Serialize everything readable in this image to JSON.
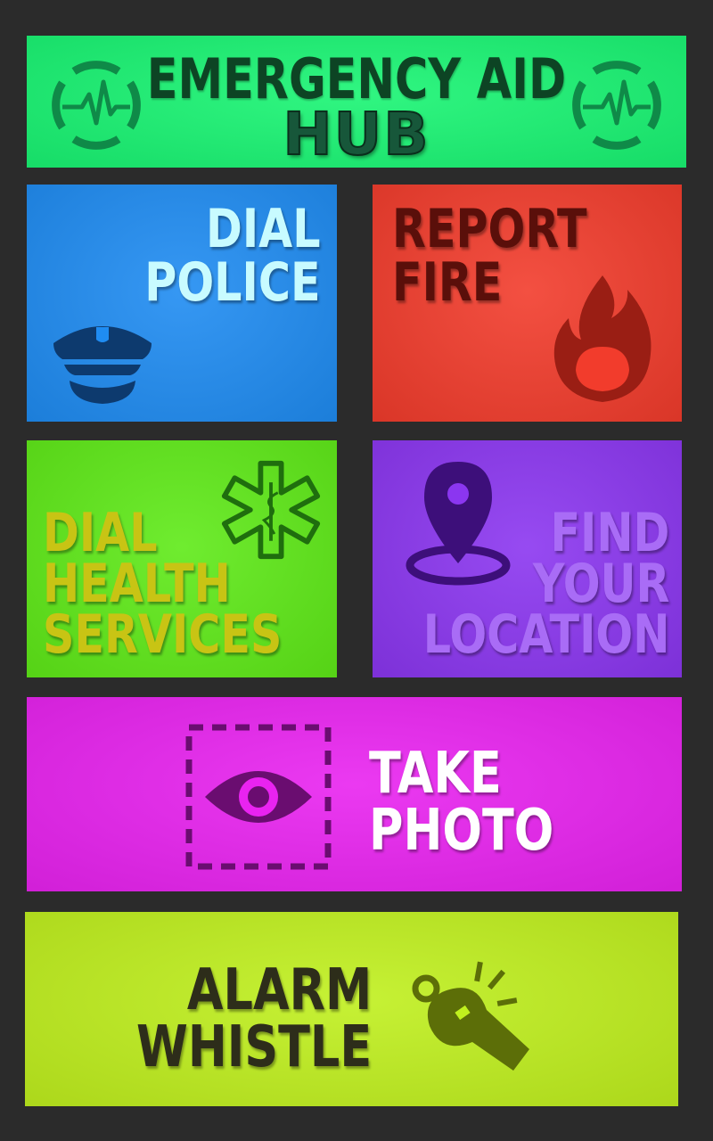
{
  "app": {
    "title_line1": "EMERGENCY AID",
    "title_line2": "HUB",
    "left_icon": "heartbeat-icon",
    "right_icon": "heartbeat-icon",
    "color": "#19f573"
  },
  "tiles": {
    "police": {
      "line1": "DIAL",
      "line2": "POLICE",
      "icon": "police-cap-icon",
      "color": "#1f8cf2",
      "text_color": "#c8fbff"
    },
    "fire": {
      "line1": "REPORT",
      "line2": "FIRE",
      "icon": "flame-icon",
      "color": "#f23c2c",
      "text_color": "#5a0f0a"
    },
    "health": {
      "line1": "DIAL",
      "line2": "HEALTH",
      "line3": "SERVICES",
      "icon": "star-of-life-icon",
      "color": "#5fea18",
      "text_color": "#c8c414"
    },
    "location": {
      "line1": "FIND",
      "line2": "YOUR",
      "line3": "LOCATION",
      "icon": "map-pin-icon",
      "color": "#8b36f0",
      "text_color": "#a96cf6"
    },
    "photo": {
      "line1": "TAKE",
      "line2": "PHOTO",
      "icon": "camera-eye-icon",
      "color": "#e923f0",
      "text_color": "#ffffff"
    },
    "whistle": {
      "line1": "ALARM",
      "line2": "WHISTLE",
      "icon": "whistle-icon",
      "color": "#c0f01e",
      "text_color": "#2d2d1a"
    }
  }
}
